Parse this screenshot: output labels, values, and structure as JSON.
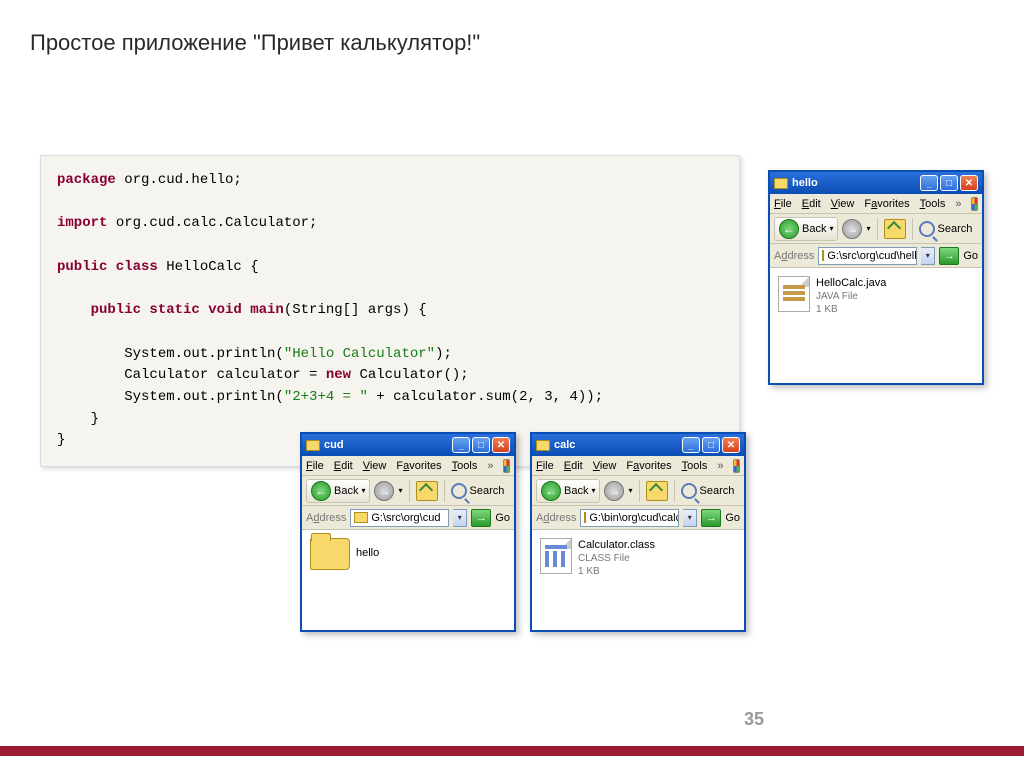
{
  "slide": {
    "title": "Простое приложение \"Привет калькулятор!\"",
    "pageNumber": "35"
  },
  "code": {
    "package_kw": "package",
    "package_name": " org.cud.hello;",
    "import_kw": "import",
    "import_name": " org.cud.calc.Calculator;",
    "class_decl_kw": "public class ",
    "class_name": "HelloCalc {",
    "main_decl": "    public static void main",
    "main_args": "(String[] args) {",
    "line1a": "        System.out.println(",
    "line1b": "\"Hello Calculator\"",
    "line1c": ");",
    "line2a": "        Calculator calculator = ",
    "line2b": "new",
    "line2c": " Calculator();",
    "line3a": "        System.out.println(",
    "line3b": "\"2+3+4 = \"",
    "line3c": " + calculator.sum(2, 3, 4));",
    "close1": "    }",
    "close2": "}"
  },
  "ui": {
    "menu": {
      "file": "File",
      "edit": "Edit",
      "view": "View",
      "favorites": "Favorites",
      "tools": "Tools",
      "chev": "»"
    },
    "toolbar": {
      "back": "Back",
      "search": "Search",
      "dropdown": "▾",
      "arrow_left": "←",
      "arrow_right": "→"
    },
    "address": {
      "label": "Address",
      "go": "Go",
      "arrow": "→"
    }
  },
  "windows": {
    "hello": {
      "title": "hello",
      "path": "G:\\src\\org\\cud\\hello",
      "file": {
        "name": "HelloCalc.java",
        "type": "JAVA File",
        "size": "1 KB"
      }
    },
    "cud": {
      "title": "cud",
      "path": "G:\\src\\org\\cud",
      "folder": "hello"
    },
    "calc": {
      "title": "calc",
      "path": "G:\\bin\\org\\cud\\calc",
      "file": {
        "name": "Calculator.class",
        "type": "CLASS File",
        "size": "1 KB"
      }
    }
  },
  "winbtns": {
    "min": "_",
    "max": "□",
    "close": "✕"
  }
}
